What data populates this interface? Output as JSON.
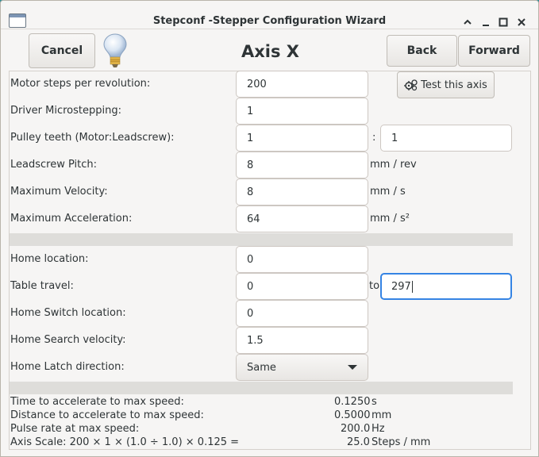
{
  "window": {
    "title": "Stepconf -Stepper Configuration Wizard"
  },
  "toolbar": {
    "cancel_label": "Cancel",
    "back_label": "Back",
    "forward_label": "Forward",
    "page_title": "Axis X"
  },
  "test_button_label": "Test this axis",
  "motor": {
    "steps_label": "Motor steps per revolution:",
    "steps_value": "200",
    "microstep_label": "Driver Microstepping:",
    "microstep_value": "1",
    "pulley_label": "Pulley teeth (Motor:Leadscrew):",
    "pulley_motor": "1",
    "pulley_separator": ":",
    "pulley_leadscrew": "1",
    "pitch_label": "Leadscrew Pitch:",
    "pitch_value": "8",
    "pitch_unit": "mm / rev",
    "velocity_label": "Maximum Velocity:",
    "velocity_value": "8",
    "velocity_unit": "mm / s",
    "accel_label": "Maximum Acceleration:",
    "accel_value": "64",
    "accel_unit": "mm / s²"
  },
  "home": {
    "location_label": "Home location:",
    "location_value": "0",
    "travel_label": "Table travel:",
    "travel_min": "0",
    "travel_to": "to",
    "travel_max": "297",
    "switch_label": "Home Switch location:",
    "switch_value": "0",
    "search_label": "Home Search velocity:",
    "search_value": "1.5",
    "latch_label": "Home Latch direction:",
    "latch_value": "Same"
  },
  "stats": {
    "accel_time_label": "Time to accelerate to max speed:",
    "accel_time_value": "0.1250",
    "accel_time_unit": "s",
    "accel_dist_label": "Distance to accelerate to max speed:",
    "accel_dist_value": "0.5000",
    "accel_dist_unit": "mm",
    "pulse_label": "Pulse rate at max speed:",
    "pulse_value": "200.0",
    "pulse_unit": "Hz",
    "scale_label": "Axis Scale: 200 × 1 × (1.0 ÷ 1.0) × 0.125 =",
    "scale_value": "25.0",
    "scale_unit": "Steps / mm"
  },
  "colors": {
    "focus": "#3584e4",
    "desktop": "#2e8f97"
  }
}
